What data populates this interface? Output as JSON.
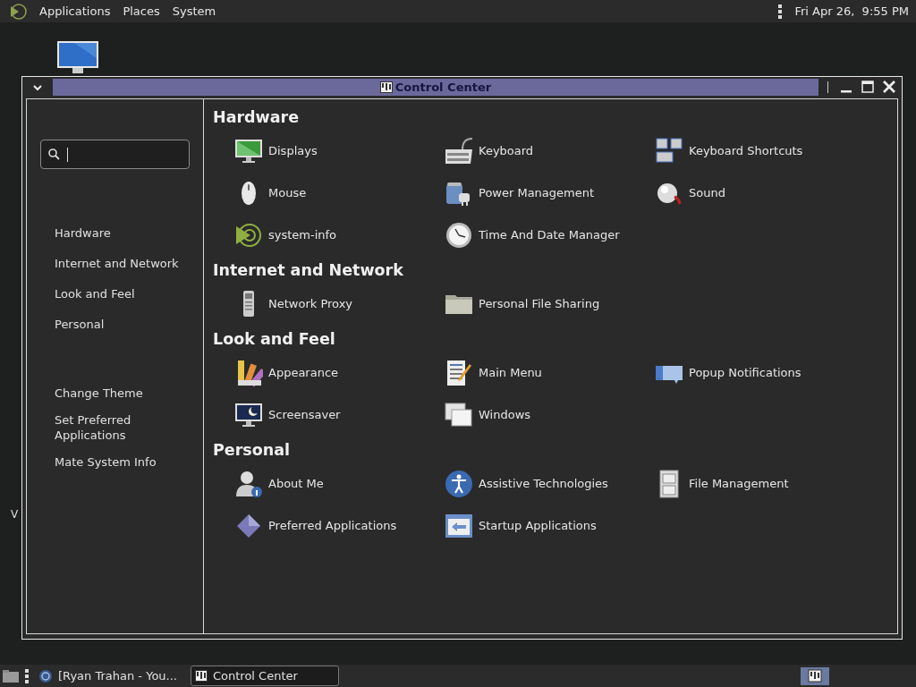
{
  "top_panel": {
    "menus": [
      "Applications",
      "Places",
      "System"
    ],
    "clock": "Fri Apr 26,  9:55 PM"
  },
  "desktop": {
    "cut_label": "V"
  },
  "window": {
    "title": "Control Center"
  },
  "sidebar": {
    "categories": [
      "Hardware",
      "Internet and Network",
      "Look and Feel",
      "Personal"
    ],
    "tasks": [
      "Change Theme",
      "Set Preferred Applications",
      "Mate System Info"
    ]
  },
  "sections": [
    {
      "title": "Hardware",
      "items": [
        {
          "label": "Displays"
        },
        {
          "label": "Keyboard"
        },
        {
          "label": "Keyboard Shortcuts"
        },
        {
          "label": "Mouse"
        },
        {
          "label": "Power Management"
        },
        {
          "label": "Sound"
        },
        {
          "label": "system-info"
        },
        {
          "label": "Time And Date Manager"
        }
      ]
    },
    {
      "title": "Internet and Network",
      "items": [
        {
          "label": "Network Proxy"
        },
        {
          "label": "Personal File Sharing"
        }
      ]
    },
    {
      "title": "Look and Feel",
      "items": [
        {
          "label": "Appearance"
        },
        {
          "label": "Main Menu"
        },
        {
          "label": "Popup Notifications"
        },
        {
          "label": "Screensaver"
        },
        {
          "label": "Windows"
        }
      ]
    },
    {
      "title": "Personal",
      "items": [
        {
          "label": "About Me"
        },
        {
          "label": "Assistive Technologies"
        },
        {
          "label": "File Management"
        },
        {
          "label": "Preferred Applications"
        },
        {
          "label": "Startup Applications"
        }
      ]
    }
  ],
  "taskbar": {
    "items": [
      {
        "label": "[Ryan Trahan - You...",
        "selected": false
      },
      {
        "label": "Control Center",
        "selected": true
      }
    ]
  }
}
